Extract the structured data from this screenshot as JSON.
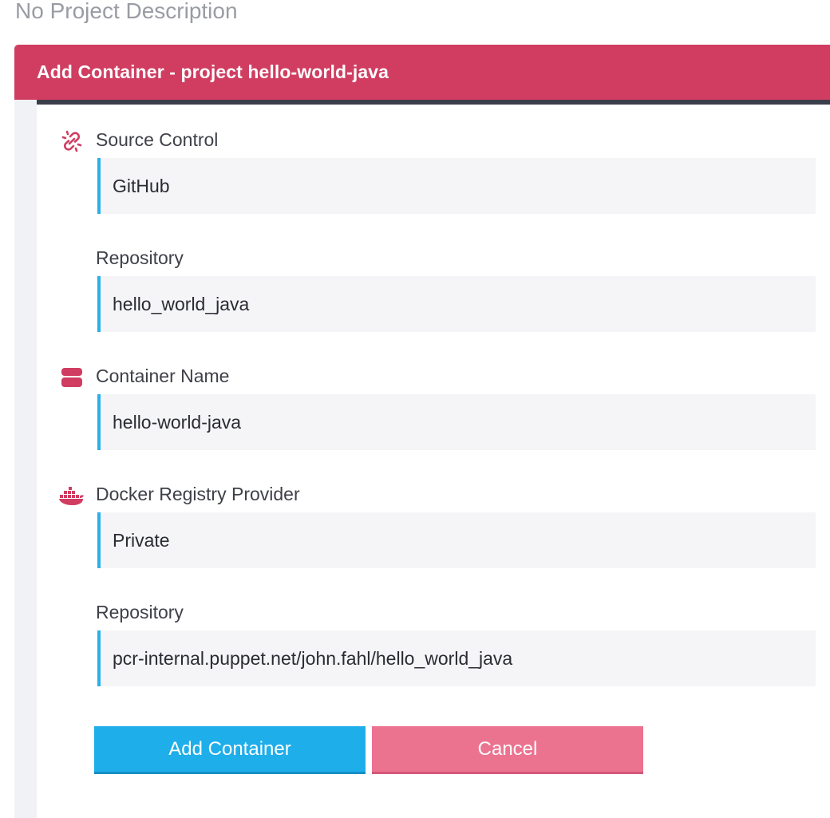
{
  "project": {
    "description": "No Project Description"
  },
  "panel": {
    "title": "Add Container - project hello-world-java"
  },
  "source_control": {
    "label": "Source Control",
    "icon": "link-broken-icon",
    "value": "GitHub",
    "repository_label": "Repository",
    "repository_value": "hello_world_java"
  },
  "container": {
    "label": "Container Name",
    "icon": "database-icon",
    "value": "hello-world-java"
  },
  "registry": {
    "label": "Docker Registry Provider",
    "icon": "docker-icon",
    "value": "Private",
    "repository_label": "Repository",
    "repository_value": "pcr-internal.puppet.net/john.fahl/hello_world_java"
  },
  "actions": {
    "add_label": "Add Container",
    "cancel_label": "Cancel"
  },
  "colors": {
    "accent": "#d03d61",
    "primary_button": "#1eaeea",
    "cancel_button": "#ec7390",
    "field_border": "#2bb0e8"
  }
}
